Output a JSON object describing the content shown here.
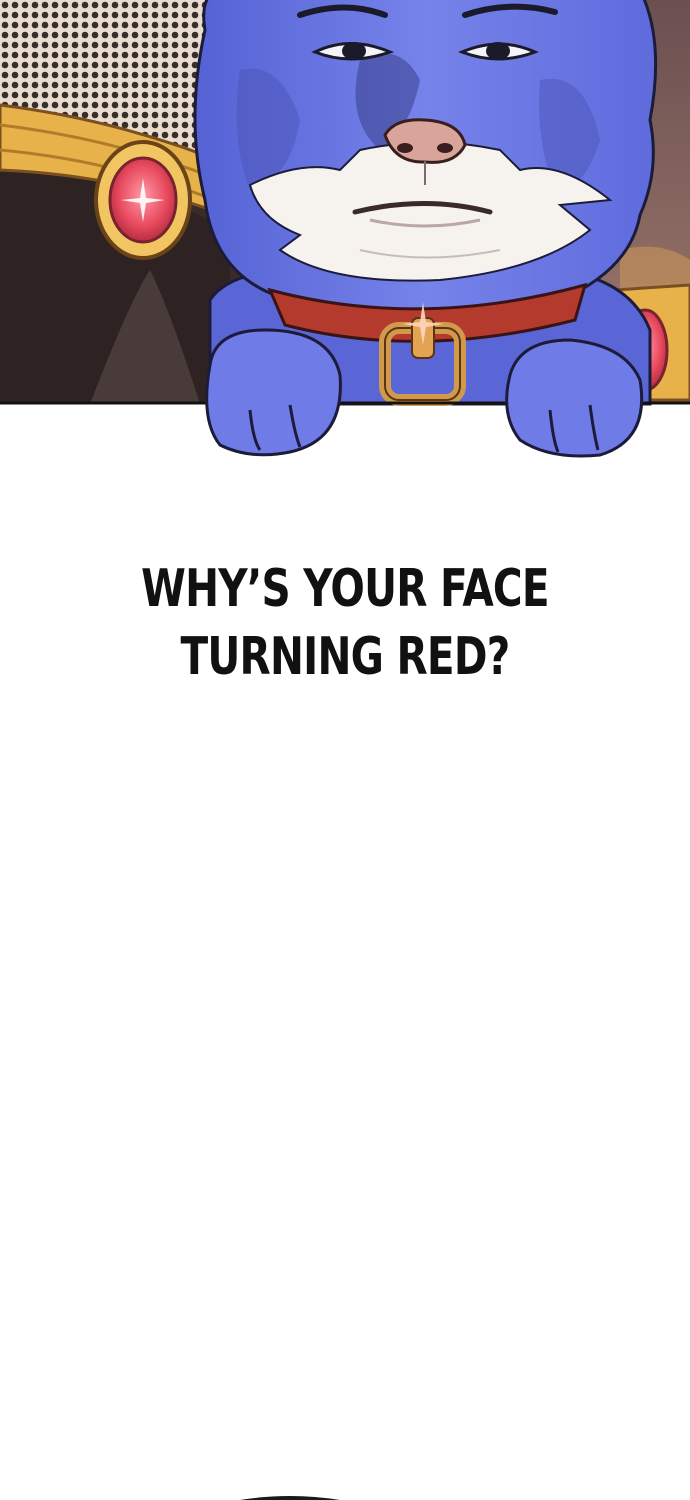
{
  "caption": {
    "line1": "WHY’S YOUR FACE",
    "line2": "TURNING RED?"
  },
  "colors": {
    "background": "#ffffff",
    "cat_blue": "#6f7be6",
    "collar_red": "#b53a2e",
    "gold": "#e8b24a",
    "gem_red": "#e94a5e",
    "text": "#111111"
  },
  "illustration": {
    "subject": "blue-cat-suit-man-peeking-over-panel-edge"
  }
}
